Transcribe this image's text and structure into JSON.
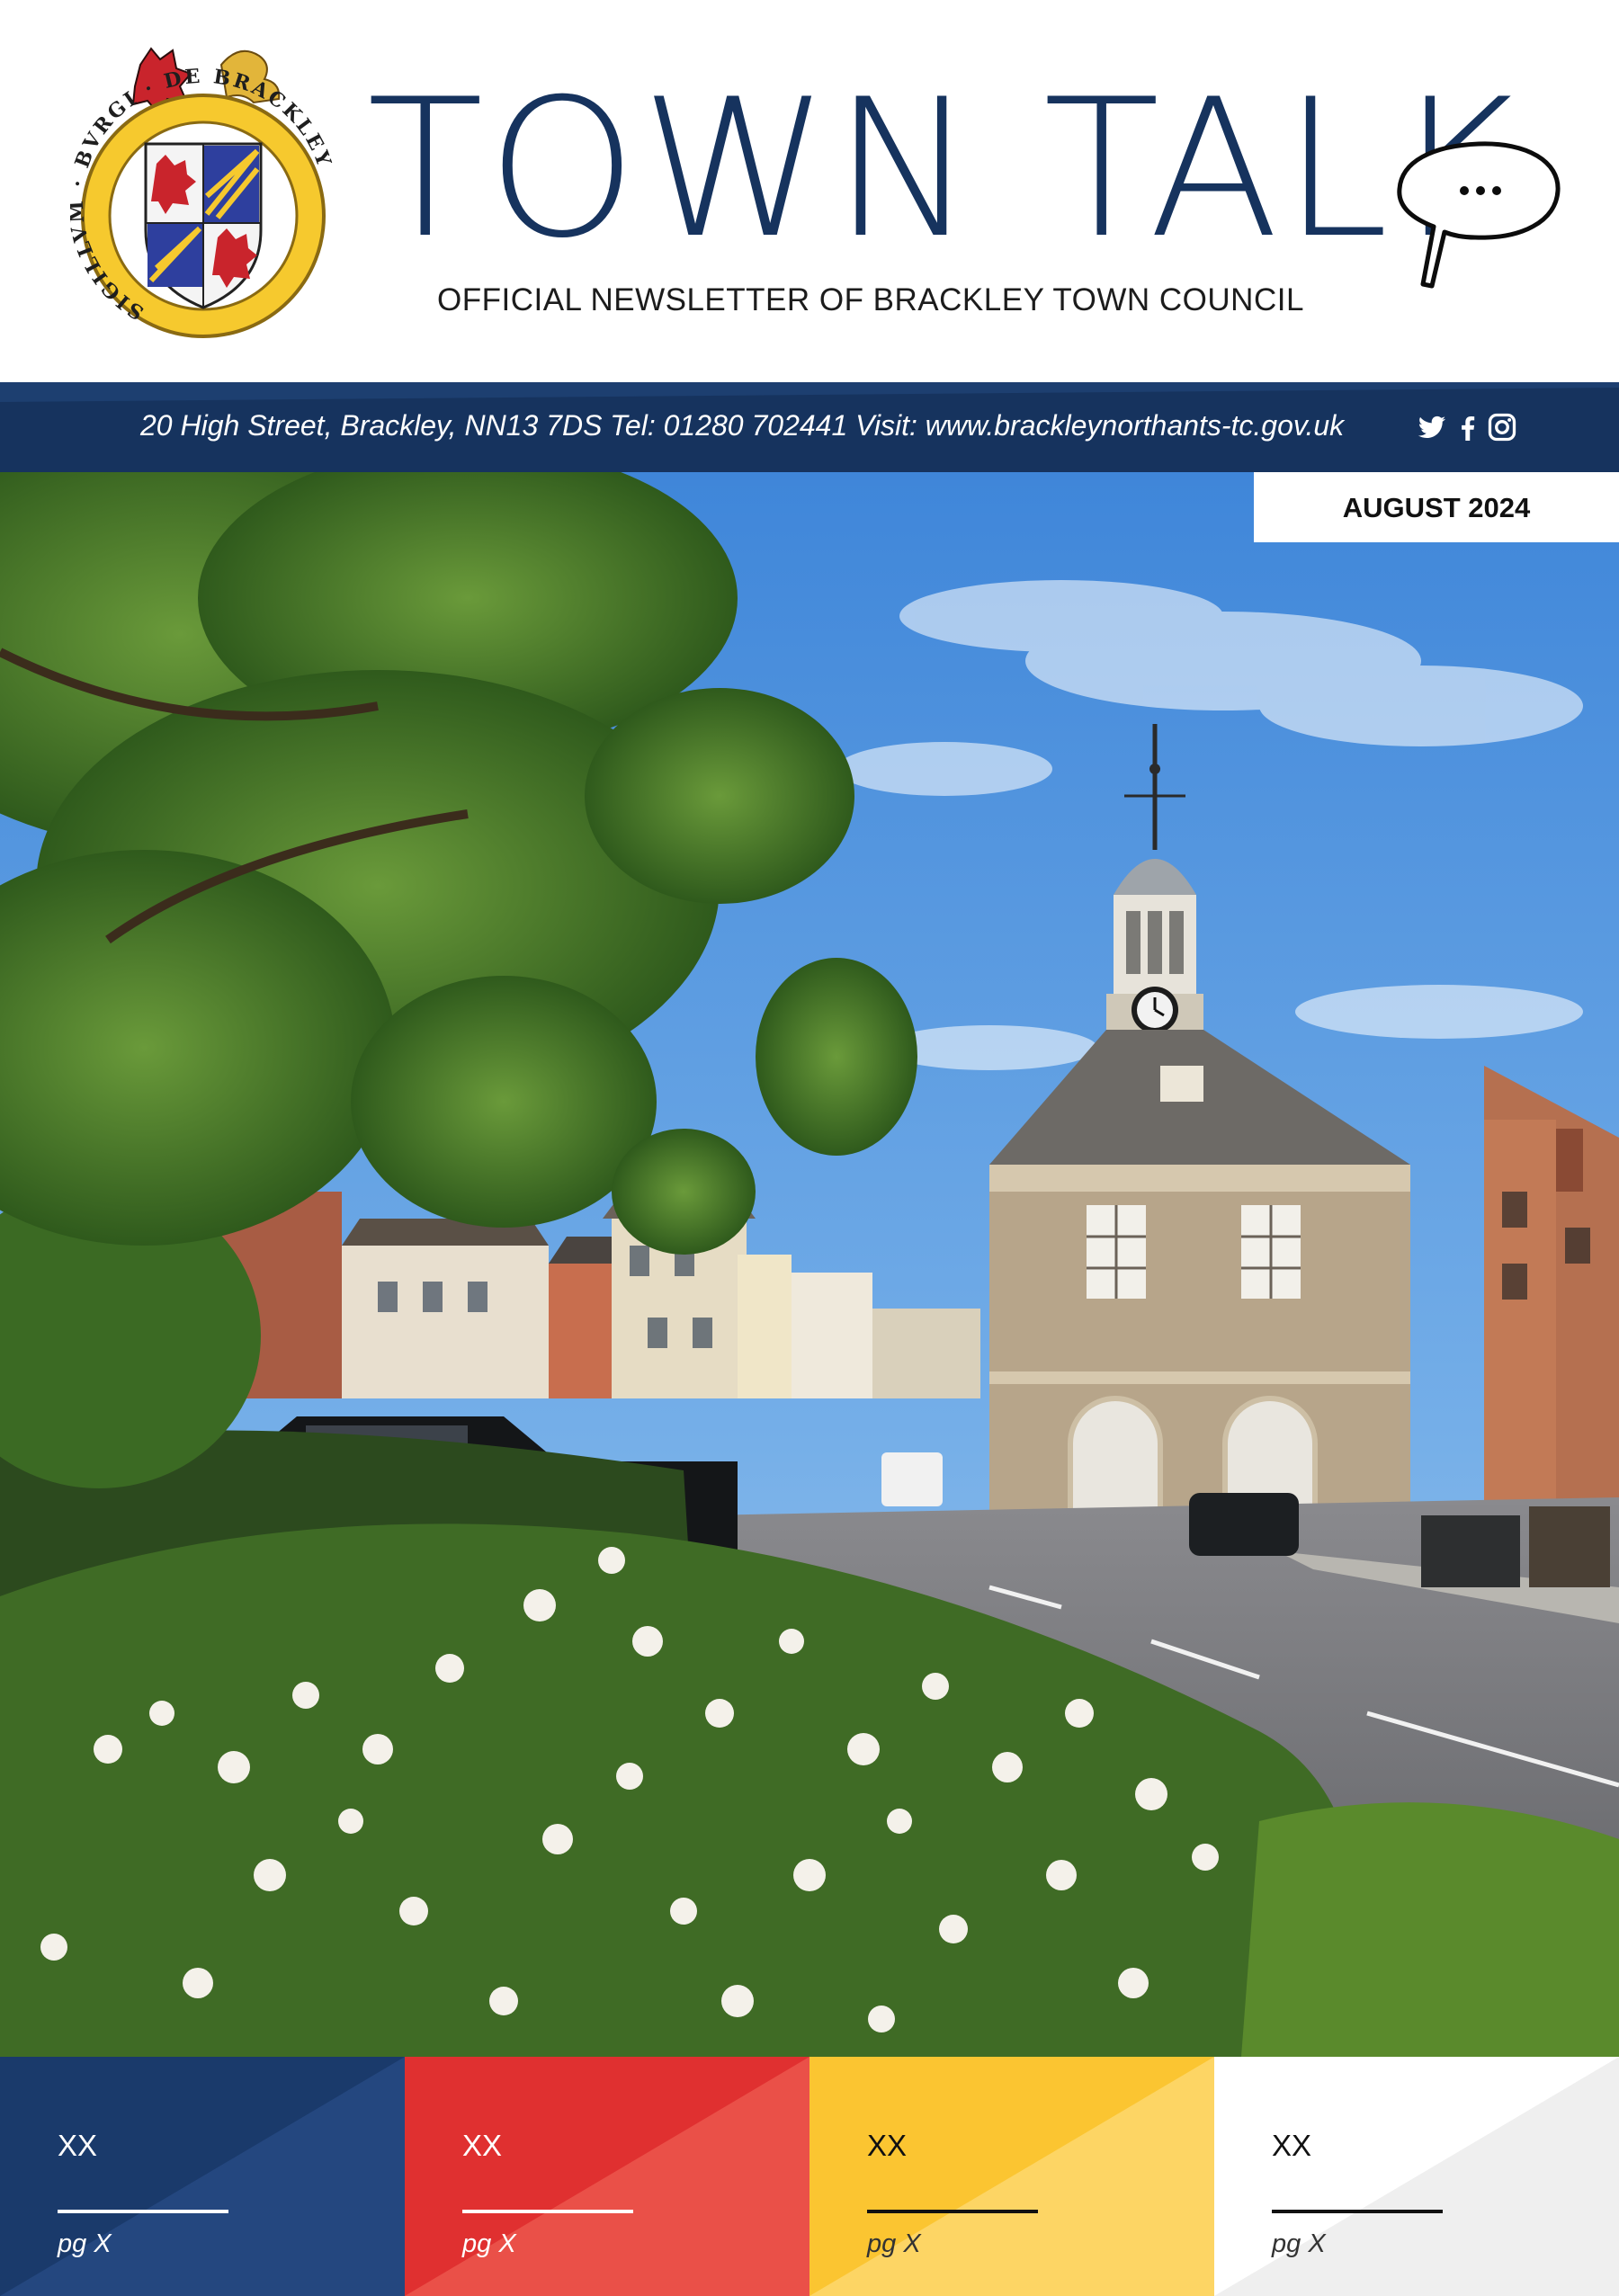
{
  "masthead": {
    "title": "TOWN TALK",
    "subtitle": "OFFICIAL NEWSLETTER OF BRACKLEY TOWN COUNCIL",
    "crest_motto": "SIGILLVM · BVRGI · DE BRACKLEY"
  },
  "contact": {
    "line": "20 High Street, Brackley, NN13 7DS Tel: 01280 702441 Visit: www.brackleynorthants-tc.gov.uk",
    "icons": [
      "twitter-icon",
      "facebook-icon",
      "instagram-icon"
    ]
  },
  "issue": {
    "date": "AUGUST 2024"
  },
  "cover_photo": {
    "description_icon": "town-hall-photo"
  },
  "contents": [
    {
      "label": "XX",
      "page": "pg X",
      "color": "#1a3a6b",
      "accent": "#24477f",
      "text_color": "#ffffff"
    },
    {
      "label": "XX",
      "page": "pg X",
      "color": "#e03030",
      "accent": "#ea5048",
      "text_color": "#ffffff"
    },
    {
      "label": "XX",
      "page": "pg X",
      "color": "#fbc531",
      "accent": "#fdd564",
      "text_color": "#111111"
    },
    {
      "label": "XX",
      "page": "pg X",
      "color": "#ffffff",
      "accent": "#efefef",
      "text_color": "#111111"
    }
  ],
  "colors": {
    "navy": "#16335e",
    "red": "#e03030",
    "yellow": "#fbc531"
  }
}
